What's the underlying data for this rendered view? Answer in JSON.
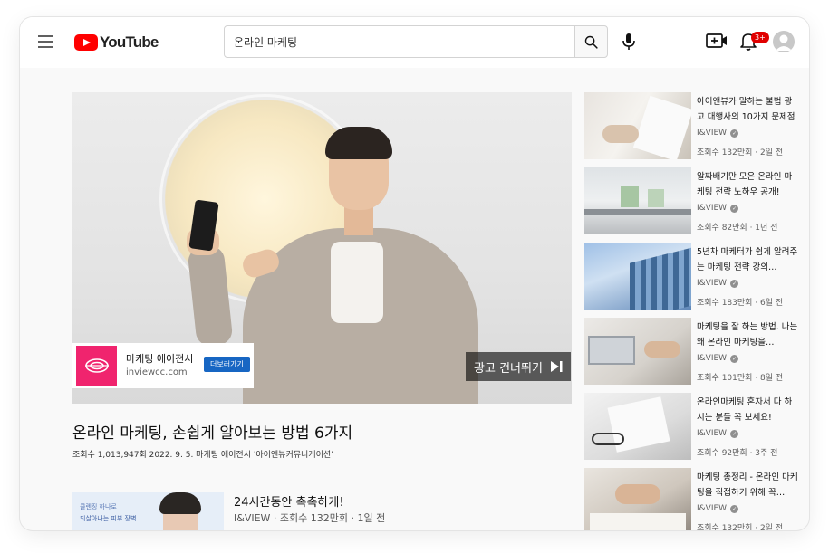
{
  "header": {
    "logo_text": "YouTube",
    "search_value": "온라인 마케팅",
    "notification_count": "3+"
  },
  "icons": {
    "menu": "hamburger-menu-icon",
    "search": "search-icon",
    "mic": "mic-icon",
    "create": "create-video-icon",
    "notifications": "bell-icon",
    "avatar": "account-avatar-icon"
  },
  "player": {
    "ad_name": "마케팅 에이전시",
    "ad_url": "inviewcc.com",
    "ad_visit": "더보러가기",
    "skip_label": "광고 건너뛰기"
  },
  "video": {
    "title": "온라인 마케팅, 손쉽게 알아보는 방법 6가지",
    "meta": "조회수 1,013,947회 2022. 9. 5. 마케팅 에이전시 '아이앤뷰커뮤니케이션'"
  },
  "next_video": {
    "thumb_line1": "클렌징 하나로",
    "thumb_line2": "되살아나는 피부 장벽",
    "title": "24시간동안 촉촉하게!",
    "meta": "I&VIEW · 조회수 132만회 · 1일 전"
  },
  "sidebar": [
    {
      "title": "아이앤뷰가 말하는 불법 광고 대행사의 10가지 문제점",
      "channel": "I&VIEW",
      "meta": "조회수 132만회 · 2일 전"
    },
    {
      "title": "알짜배기만 모은 온라인 마케팅 전략 노하우 공개!",
      "channel": "I&VIEW",
      "meta": "조회수 82만회 · 1년 전"
    },
    {
      "title": "5년차 마케터가 쉽게 알려주는 마케팅 전략 강의…",
      "channel": "I&VIEW",
      "meta": "조회수 183만회 · 6일 전"
    },
    {
      "title": "마케팅을 잘 하는 방법. 나는 왜 온라인 마케팅을…",
      "channel": "I&VIEW",
      "meta": "조회수 101만회 · 8일 전"
    },
    {
      "title": "온라인마케팅 혼자서 다 하시는 분들 꼭 보세요!",
      "channel": "I&VIEW",
      "meta": "조회수 92만회 · 3주 전"
    },
    {
      "title": "마케팅 총정리 - 온라인 마케팅을 직접하기 위해 꼭…",
      "channel": "I&VIEW",
      "meta": "조회수 132만회 · 2일 전"
    }
  ],
  "colors": {
    "brand_red": "#ff0000",
    "ad_pink": "#f0246e",
    "ad_button_blue": "#1766c3",
    "badge_red": "#e00000"
  }
}
